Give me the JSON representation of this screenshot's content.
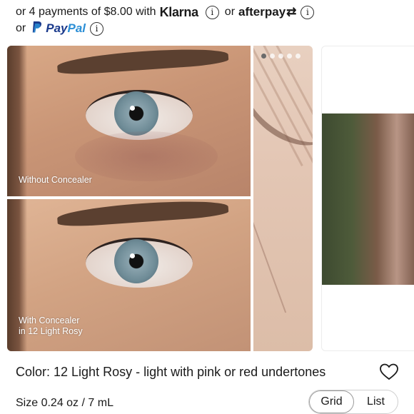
{
  "payments": {
    "row1": {
      "prefix": "or 4 payments of $8.00 with",
      "klarna": "Klarna",
      "or": "or",
      "afterpay": "afterpay",
      "afterpay_symbol": "⇄"
    },
    "row2": {
      "or": "or",
      "paypal_pay": "Pay",
      "paypal_pal": "Pal"
    },
    "info_glyph": "i"
  },
  "gallery": {
    "dots": {
      "count": 5,
      "active_index": 0
    },
    "captions": {
      "top": "Without Concealer",
      "bottom_line1": "With Concealer",
      "bottom_line2": "in 12 Light Rosy"
    }
  },
  "product": {
    "color_label": "Color: 12 Light Rosy - light with pink or red undertones",
    "size_label": "Size 0.24 oz / 7 mL"
  },
  "view_toggle": {
    "options": [
      "Grid",
      "List"
    ],
    "selected": "Grid"
  },
  "icons": {
    "info": "info-circle-icon",
    "paypal": "paypal-p-icon",
    "wishlist": "heart-outline-icon"
  },
  "colors": {
    "paypal_dark": "#1a3a8c",
    "paypal_light": "#2c8fd6",
    "text": "#1a1a1a"
  }
}
